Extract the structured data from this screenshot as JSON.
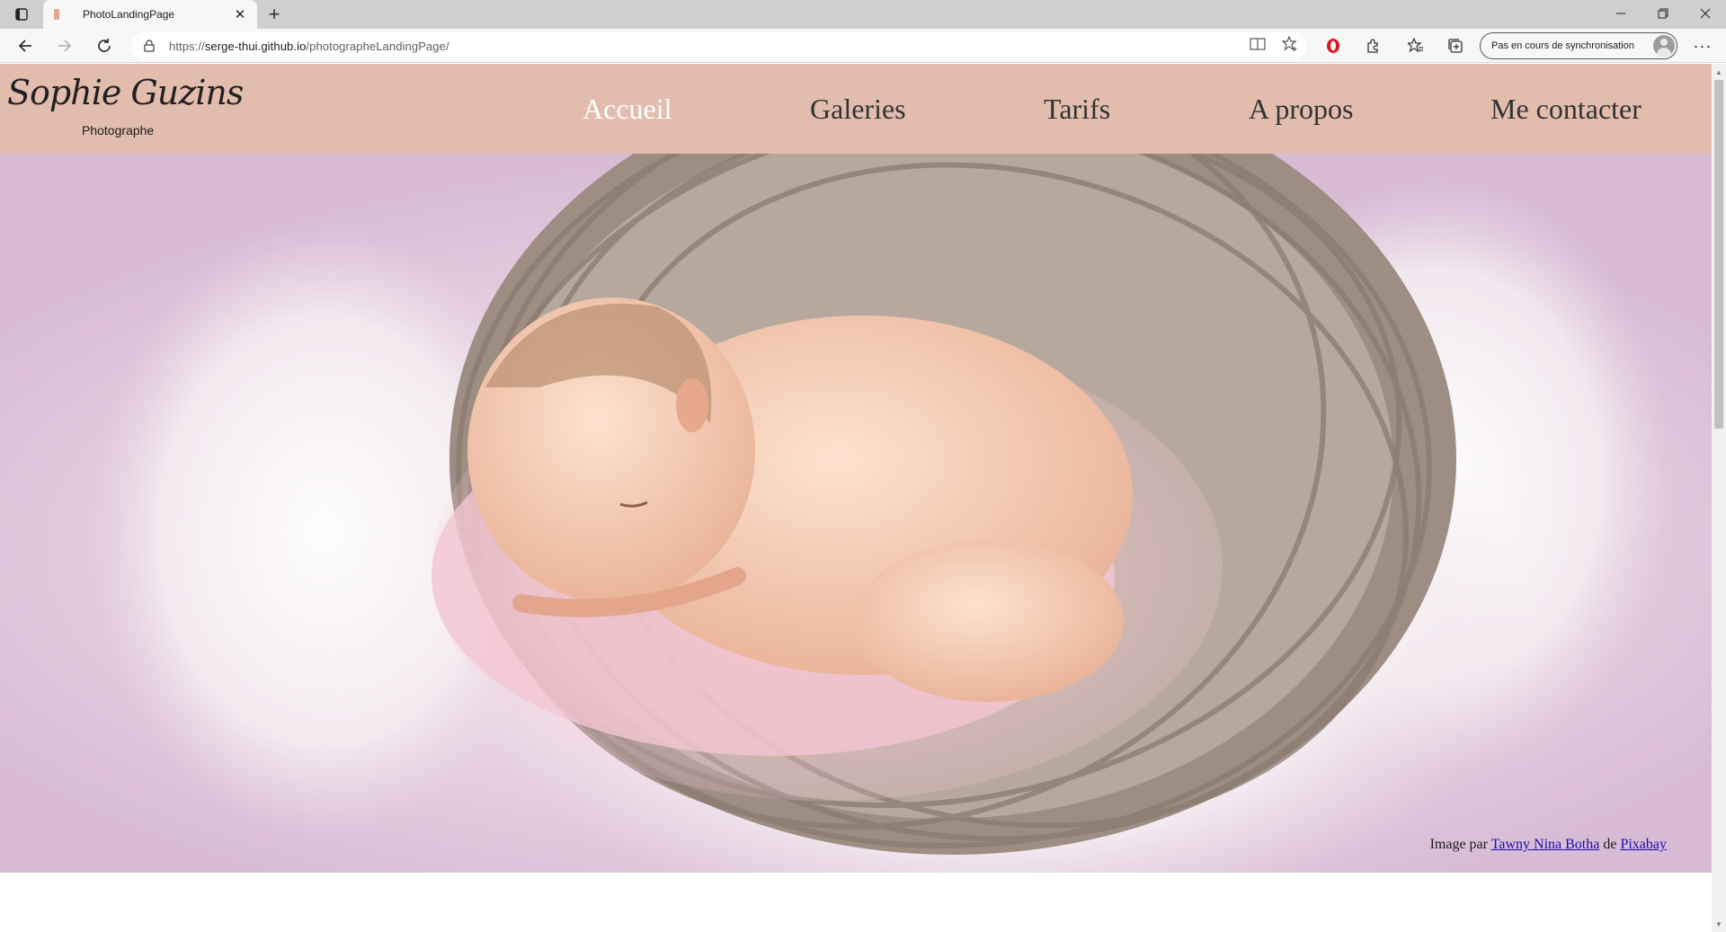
{
  "browser": {
    "tab": {
      "title": "PhotoLandingPage"
    },
    "address": {
      "url_prefix": "https://",
      "url_host": "serge-thui.github.io",
      "url_path": "/photographeLandingPage/"
    },
    "profile": {
      "sync_label": "Pas en cours de synchronisation"
    }
  },
  "site": {
    "logo": {
      "script": "Sophie Guzins",
      "subtitle": "Photographe"
    },
    "nav": [
      {
        "label": "Accueil",
        "active": true
      },
      {
        "label": "Galeries",
        "active": false
      },
      {
        "label": "Tarifs",
        "active": false
      },
      {
        "label": "A propos",
        "active": false
      },
      {
        "label": "Me contacter",
        "active": false
      }
    ],
    "hero": {
      "credit_prefix": "Image par ",
      "credit_author": "Tawny Nina Botha",
      "credit_middle": " de ",
      "credit_source": "Pixabay"
    }
  },
  "colors": {
    "header_bg": "#e2bdad",
    "nav_active": "#ffffff",
    "nav_text": "#333333",
    "link": "#1a0dab"
  }
}
